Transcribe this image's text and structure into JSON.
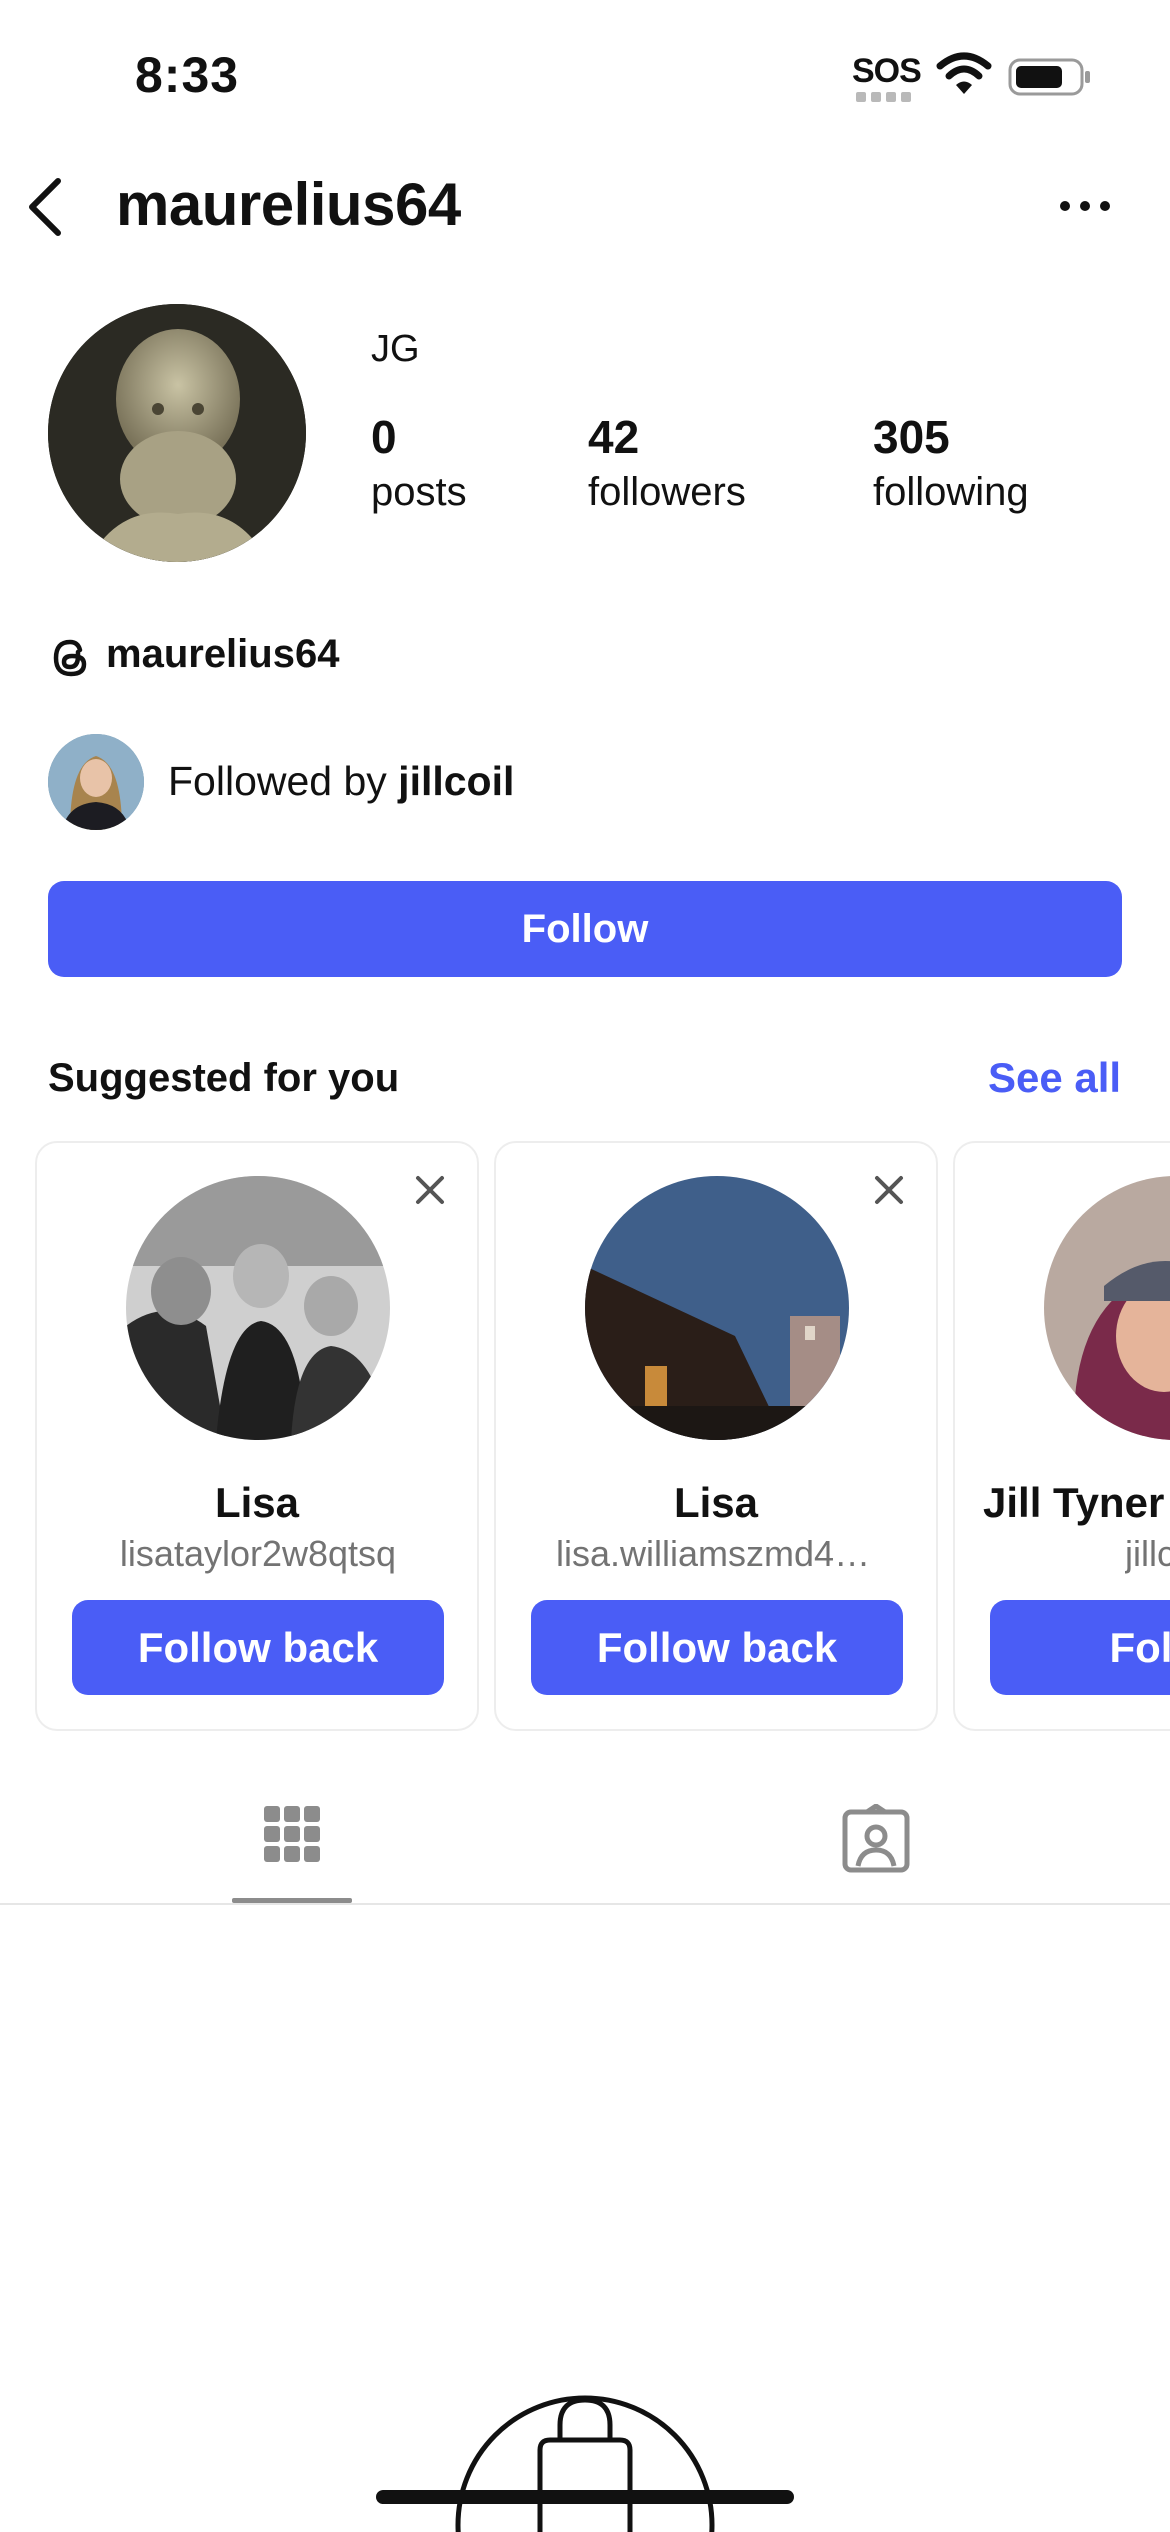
{
  "status_bar": {
    "time": "8:33",
    "sos": "SOS",
    "icons": [
      "wifi-icon",
      "battery-icon"
    ]
  },
  "header": {
    "username": "maurelius64",
    "icons": [
      "chevron-left-icon",
      "more-horizontal-icon"
    ]
  },
  "profile": {
    "display_name": "JG",
    "stats": {
      "posts": {
        "count": "0",
        "label": "posts"
      },
      "followers": {
        "count": "42",
        "label": "followers"
      },
      "following": {
        "count": "305",
        "label": "following"
      }
    },
    "threads_handle": "maurelius64",
    "followed_by_prefix": "Followed by ",
    "followed_by_user": "jillcoil",
    "follow_label": "Follow"
  },
  "suggested": {
    "title": "Suggested for you",
    "see_all": "See all",
    "cards": [
      {
        "name": "Lisa",
        "handle": "lisataylor2w8qtsq",
        "button": "Follow back"
      },
      {
        "name": "Lisa",
        "handle": "lisa.williamszmd49v...",
        "button": "Follow back"
      },
      {
        "name": "Jill Tyner",
        "handle": "jillc",
        "button": "Follow"
      }
    ]
  },
  "tabs": {
    "items": [
      "grid-icon",
      "tagged-icon"
    ],
    "active": "grid-icon"
  },
  "colors": {
    "accent": "#4a5df6",
    "text": "#111111",
    "muted": "#737373"
  }
}
